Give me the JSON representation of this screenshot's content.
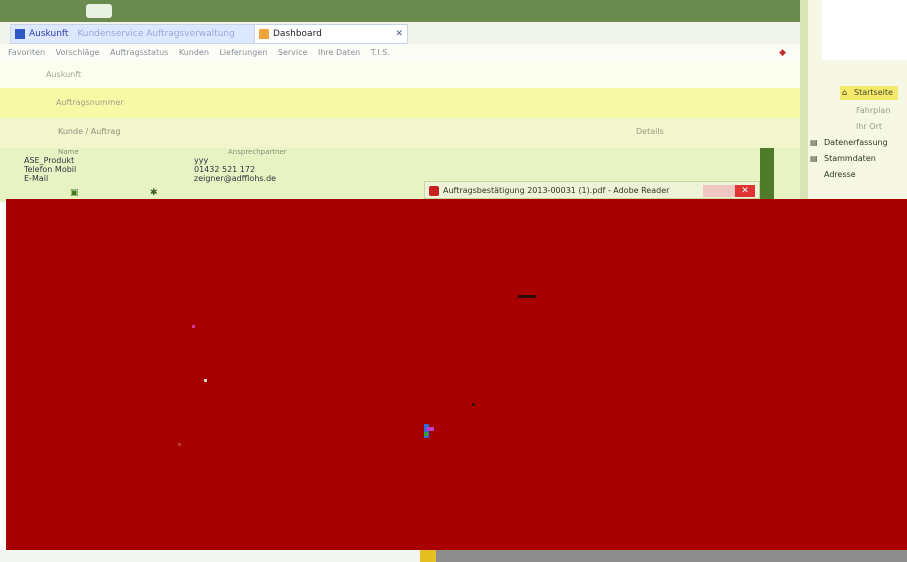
{
  "browser": {
    "tabs": [
      {
        "label": "Auskunft",
        "url_hint": "Kundenservice Auftragsverwaltung"
      },
      {
        "label": "Dashboard"
      }
    ],
    "favorites": [
      "Favoriten",
      "Vorschläge",
      "Auftragsstatus",
      "Kunden",
      "Lieferungen",
      "Service",
      "Ihre Daten",
      "T.I.S."
    ],
    "colors": {
      "titlebar": "#6b8a4f",
      "tab_active": "#dde7ff",
      "accent_red": "#a80000"
    }
  },
  "page": {
    "heading": "Auskunft",
    "field_label": "Auftragsnummer",
    "search_text": "Kunde / Auftrag",
    "side_link": "Details",
    "column_heads": [
      "Name",
      "Ansprechpartner"
    ],
    "rows": [
      {
        "label": "ASE_Produkt",
        "value": "yyy"
      },
      {
        "label": "Telefon Mobil",
        "value": "01432 521 172"
      },
      {
        "label": "E-Mail",
        "value": "zeigner@adfflohs.de"
      }
    ]
  },
  "sidebar": {
    "home": "Startseite",
    "sub1": "Fahrplan",
    "sub2": "Ihr Ort",
    "items": [
      "Datenerfassung",
      "Stammdaten",
      "Adresse"
    ]
  },
  "notice": {
    "text": "Auftragsbestätigung 2013-00031 (1).pdf - Adobe Reader"
  }
}
